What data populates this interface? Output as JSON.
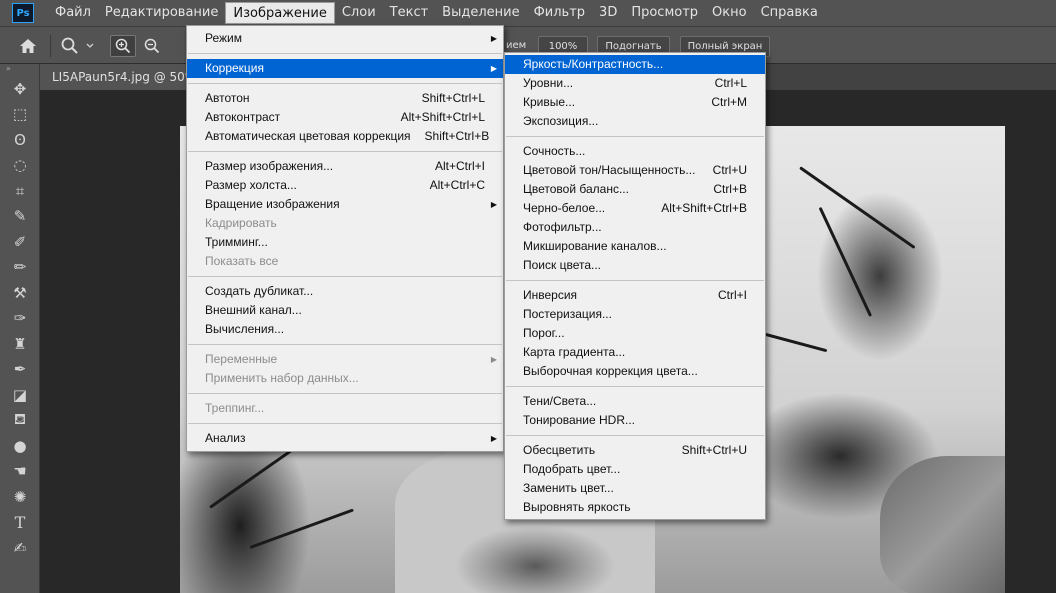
{
  "app": {
    "logo": "Ps"
  },
  "menubar": {
    "items": [
      "Файл",
      "Редактирование",
      "Изображение",
      "Слои",
      "Текст",
      "Выделение",
      "Фильтр",
      "3D",
      "Просмотр",
      "Окно",
      "Справка"
    ],
    "active_index": 2
  },
  "options_bar": {
    "label_partial": "ием",
    "zoom_value": "100%",
    "fit_button": "Подогнать",
    "fullscreen_button": "Полный экран",
    "icons": [
      "home-icon",
      "zoom-icon",
      "chevron-down-icon",
      "zoom-in-icon",
      "zoom-out-icon"
    ]
  },
  "document_tab": {
    "title": "LI5APaun5r4.jpg @ 50% (("
  },
  "toolbar": {
    "collapse_glyph": "»",
    "tools": [
      "move-icon",
      "marquee-icon",
      "lasso-icon",
      "quick-select-icon",
      "crop-icon",
      "eyedropper-icon",
      "healing-brush-icon",
      "brush-icon",
      "clone-stamp-icon",
      "history-brush-icon",
      "stamp-icon",
      "art-history-icon",
      "eraser-icon",
      "paint-bucket-icon",
      "blur-icon",
      "smudge-icon",
      "dodge-icon",
      "type-icon",
      "pen-icon"
    ]
  },
  "image_menu": {
    "sections": [
      [
        {
          "label": "Режим",
          "shortcut": "",
          "submenu": true,
          "disabled": false
        }
      ],
      [
        {
          "label": "Коррекция",
          "shortcut": "",
          "submenu": true,
          "disabled": false,
          "highlighted": true
        }
      ],
      [
        {
          "label": "Автотон",
          "shortcut": "Shift+Ctrl+L",
          "disabled": false
        },
        {
          "label": "Автоконтраст",
          "shortcut": "Alt+Shift+Ctrl+L",
          "disabled": false
        },
        {
          "label": "Автоматическая цветовая коррекция",
          "shortcut": "Shift+Ctrl+B",
          "disabled": false
        }
      ],
      [
        {
          "label": "Размер изображения...",
          "shortcut": "Alt+Ctrl+I",
          "disabled": false
        },
        {
          "label": "Размер холста...",
          "shortcut": "Alt+Ctrl+C",
          "disabled": false
        },
        {
          "label": "Вращение изображения",
          "shortcut": "",
          "submenu": true,
          "disabled": false
        },
        {
          "label": "Кадрировать",
          "shortcut": "",
          "disabled": true
        },
        {
          "label": "Тримминг...",
          "shortcut": "",
          "disabled": false
        },
        {
          "label": "Показать все",
          "shortcut": "",
          "disabled": true
        }
      ],
      [
        {
          "label": "Создать дубликат...",
          "shortcut": "",
          "disabled": false
        },
        {
          "label": "Внешний канал...",
          "shortcut": "",
          "disabled": false
        },
        {
          "label": "Вычисления...",
          "shortcut": "",
          "disabled": false
        }
      ],
      [
        {
          "label": "Переменные",
          "shortcut": "",
          "submenu": true,
          "disabled": true
        },
        {
          "label": "Применить набор данных...",
          "shortcut": "",
          "disabled": true
        }
      ],
      [
        {
          "label": "Треппинг...",
          "shortcut": "",
          "disabled": true
        }
      ],
      [
        {
          "label": "Анализ",
          "shortcut": "",
          "submenu": true,
          "disabled": false
        }
      ]
    ]
  },
  "adjustments_menu": {
    "sections": [
      [
        {
          "label": "Яркость/Контрастность...",
          "shortcut": "",
          "highlighted": true
        },
        {
          "label": "Уровни...",
          "shortcut": "Ctrl+L"
        },
        {
          "label": "Кривые...",
          "shortcut": "Ctrl+M"
        },
        {
          "label": "Экспозиция...",
          "shortcut": ""
        }
      ],
      [
        {
          "label": "Сочность...",
          "shortcut": ""
        },
        {
          "label": "Цветовой тон/Насыщенность...",
          "shortcut": "Ctrl+U"
        },
        {
          "label": "Цветовой баланс...",
          "shortcut": "Ctrl+B"
        },
        {
          "label": "Черно-белое...",
          "shortcut": "Alt+Shift+Ctrl+B"
        },
        {
          "label": "Фотофильтр...",
          "shortcut": ""
        },
        {
          "label": "Микширование каналов...",
          "shortcut": ""
        },
        {
          "label": "Поиск цвета...",
          "shortcut": ""
        }
      ],
      [
        {
          "label": "Инверсия",
          "shortcut": "Ctrl+I"
        },
        {
          "label": "Постеризация...",
          "shortcut": ""
        },
        {
          "label": "Порог...",
          "shortcut": ""
        },
        {
          "label": "Карта градиента...",
          "shortcut": ""
        },
        {
          "label": "Выборочная коррекция цвета...",
          "shortcut": ""
        }
      ],
      [
        {
          "label": "Тени/Света...",
          "shortcut": ""
        },
        {
          "label": "Тонирование HDR...",
          "shortcut": ""
        }
      ],
      [
        {
          "label": "Обесцветить",
          "shortcut": "Shift+Ctrl+U"
        },
        {
          "label": "Подобрать цвет...",
          "shortcut": ""
        },
        {
          "label": "Заменить цвет...",
          "shortcut": ""
        },
        {
          "label": "Выровнять яркость",
          "shortcut": ""
        }
      ]
    ]
  },
  "colors": {
    "highlight": "#0064d3",
    "menu_bg": "#f0f0f0",
    "ui_bg": "#535353",
    "canvas_bg": "#282828"
  }
}
